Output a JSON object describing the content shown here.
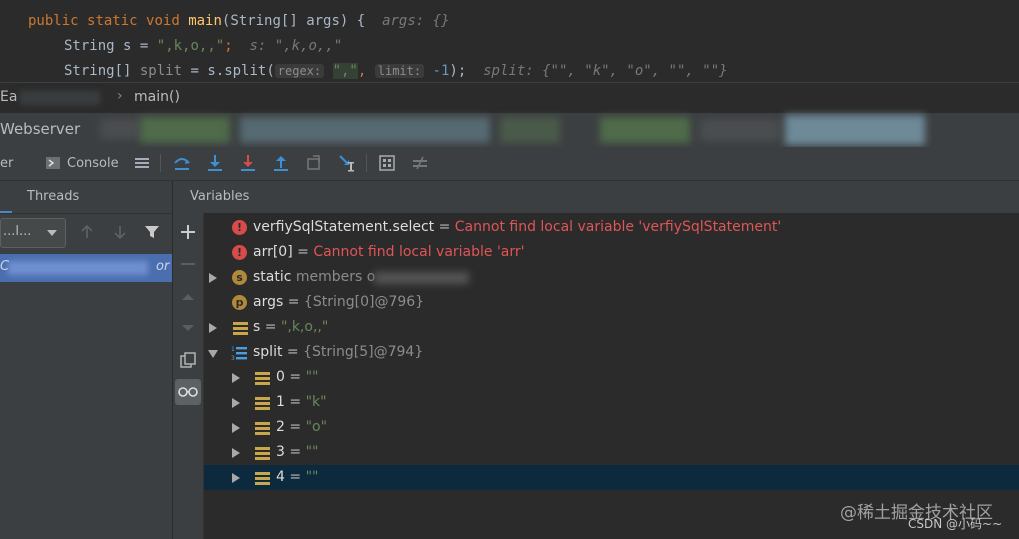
{
  "editor": {
    "line1": {
      "kw1": "public",
      "kw2": "static",
      "kw3": "void",
      "fn": "main",
      "sig": "(String[] args) {",
      "hint": "args: {}"
    },
    "line2": {
      "type": "String",
      "name": "s",
      "eq": "=",
      "literal": "\",k,o,,\"",
      "semi": ";",
      "hint": "s: \",k,o,,\""
    },
    "line3": {
      "type": "String[]",
      "name": "split",
      "eq": "=",
      "call": "s.split(",
      "hint_regex": "regex:",
      "literal": "\",\"",
      "comma": ",",
      "hint_limit": "limit:",
      "limit_value": "-1",
      "close": ");",
      "hint": "split: {\"\", \"k\", \"o\", \"\", \"\"}"
    }
  },
  "breadcrumb": {
    "left": "Ea",
    "method": "main()"
  },
  "debug": {
    "title": "Webserver"
  },
  "toolbar": {
    "tab_left": "er",
    "console": "Console",
    "icons": [
      "console-icon",
      "layout-icon",
      "step-over-icon",
      "step-into-icon",
      "force-step-into-icon",
      "step-out-icon",
      "drop-frame-icon",
      "run-to-cursor-icon",
      "evaluate-expression-icon",
      "trace-icon"
    ]
  },
  "frames": {
    "header": "Threads",
    "select_value": "...l...",
    "selected_suffix": "or",
    "selected_prefix": "C"
  },
  "variables": {
    "header": "Variables",
    "rows": [
      {
        "name": "verfiySqlStatement.select",
        "eq": "=",
        "value": "Cannot find local variable 'verfiySqlStatement'",
        "kind": "error"
      },
      {
        "name": "arr[0]",
        "eq": "=",
        "value": "Cannot find local variable 'arr'",
        "kind": "error"
      },
      {
        "name": "static",
        "value": "members o",
        "kind": "static"
      },
      {
        "name": "args",
        "eq": "=",
        "value": "{String[0]@796}",
        "kind": "param"
      },
      {
        "name": "s",
        "eq": "=",
        "value": "\",k,o,,\"",
        "kind": "field"
      },
      {
        "name": "split",
        "eq": "=",
        "value": "{String[5]@794}",
        "kind": "array"
      },
      {
        "name": "0",
        "eq": "=",
        "value": "\"\"",
        "kind": "field"
      },
      {
        "name": "1",
        "eq": "=",
        "value": "\"k\"",
        "kind": "field"
      },
      {
        "name": "2",
        "eq": "=",
        "value": "\"o\"",
        "kind": "field"
      },
      {
        "name": "3",
        "eq": "=",
        "value": "\"\"",
        "kind": "field"
      },
      {
        "name": "4",
        "eq": "=",
        "value": "\"\"",
        "kind": "field"
      }
    ]
  },
  "watermark": {
    "line1": "@稀土掘金技术社区",
    "line2": "CSDN @小码~~"
  },
  "colors": {
    "error": "#e05555",
    "selection": "#0d293e",
    "accent": "#4b6eaf"
  }
}
